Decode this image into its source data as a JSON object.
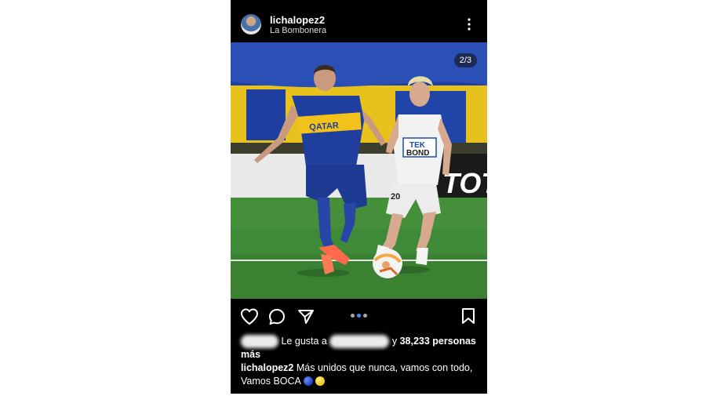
{
  "post": {
    "username": "lichalopez2",
    "location": "La Bombonera",
    "image_counter": "2/3",
    "likes": {
      "prefix": "Le gusta a",
      "separator": "y",
      "count": "38,233 personas",
      "suffix": "más"
    },
    "caption": {
      "username": "lichalopez2",
      "text": "Más unidos que nunca, vamos con todo, Vamos BOCA"
    },
    "photo": {
      "player1_sponsor": "QATAR",
      "player2_sponsor_line1": "TEK",
      "player2_sponsor_line2": "BOND",
      "board_text": "TOT",
      "player2_number": "20"
    },
    "carousel": {
      "total": 3,
      "active": 2
    }
  },
  "colors": {
    "background": "#000000",
    "boca_blue": "#1f3e9e",
    "boca_gold": "#f2c21a",
    "active_dot": "#3897f0",
    "pitch": "#3f8a36"
  },
  "icons": [
    "more-options-icon",
    "heart-icon",
    "comment-icon",
    "share-icon",
    "bookmark-icon",
    "blue-circle-emoji",
    "yellow-circle-emoji"
  ]
}
